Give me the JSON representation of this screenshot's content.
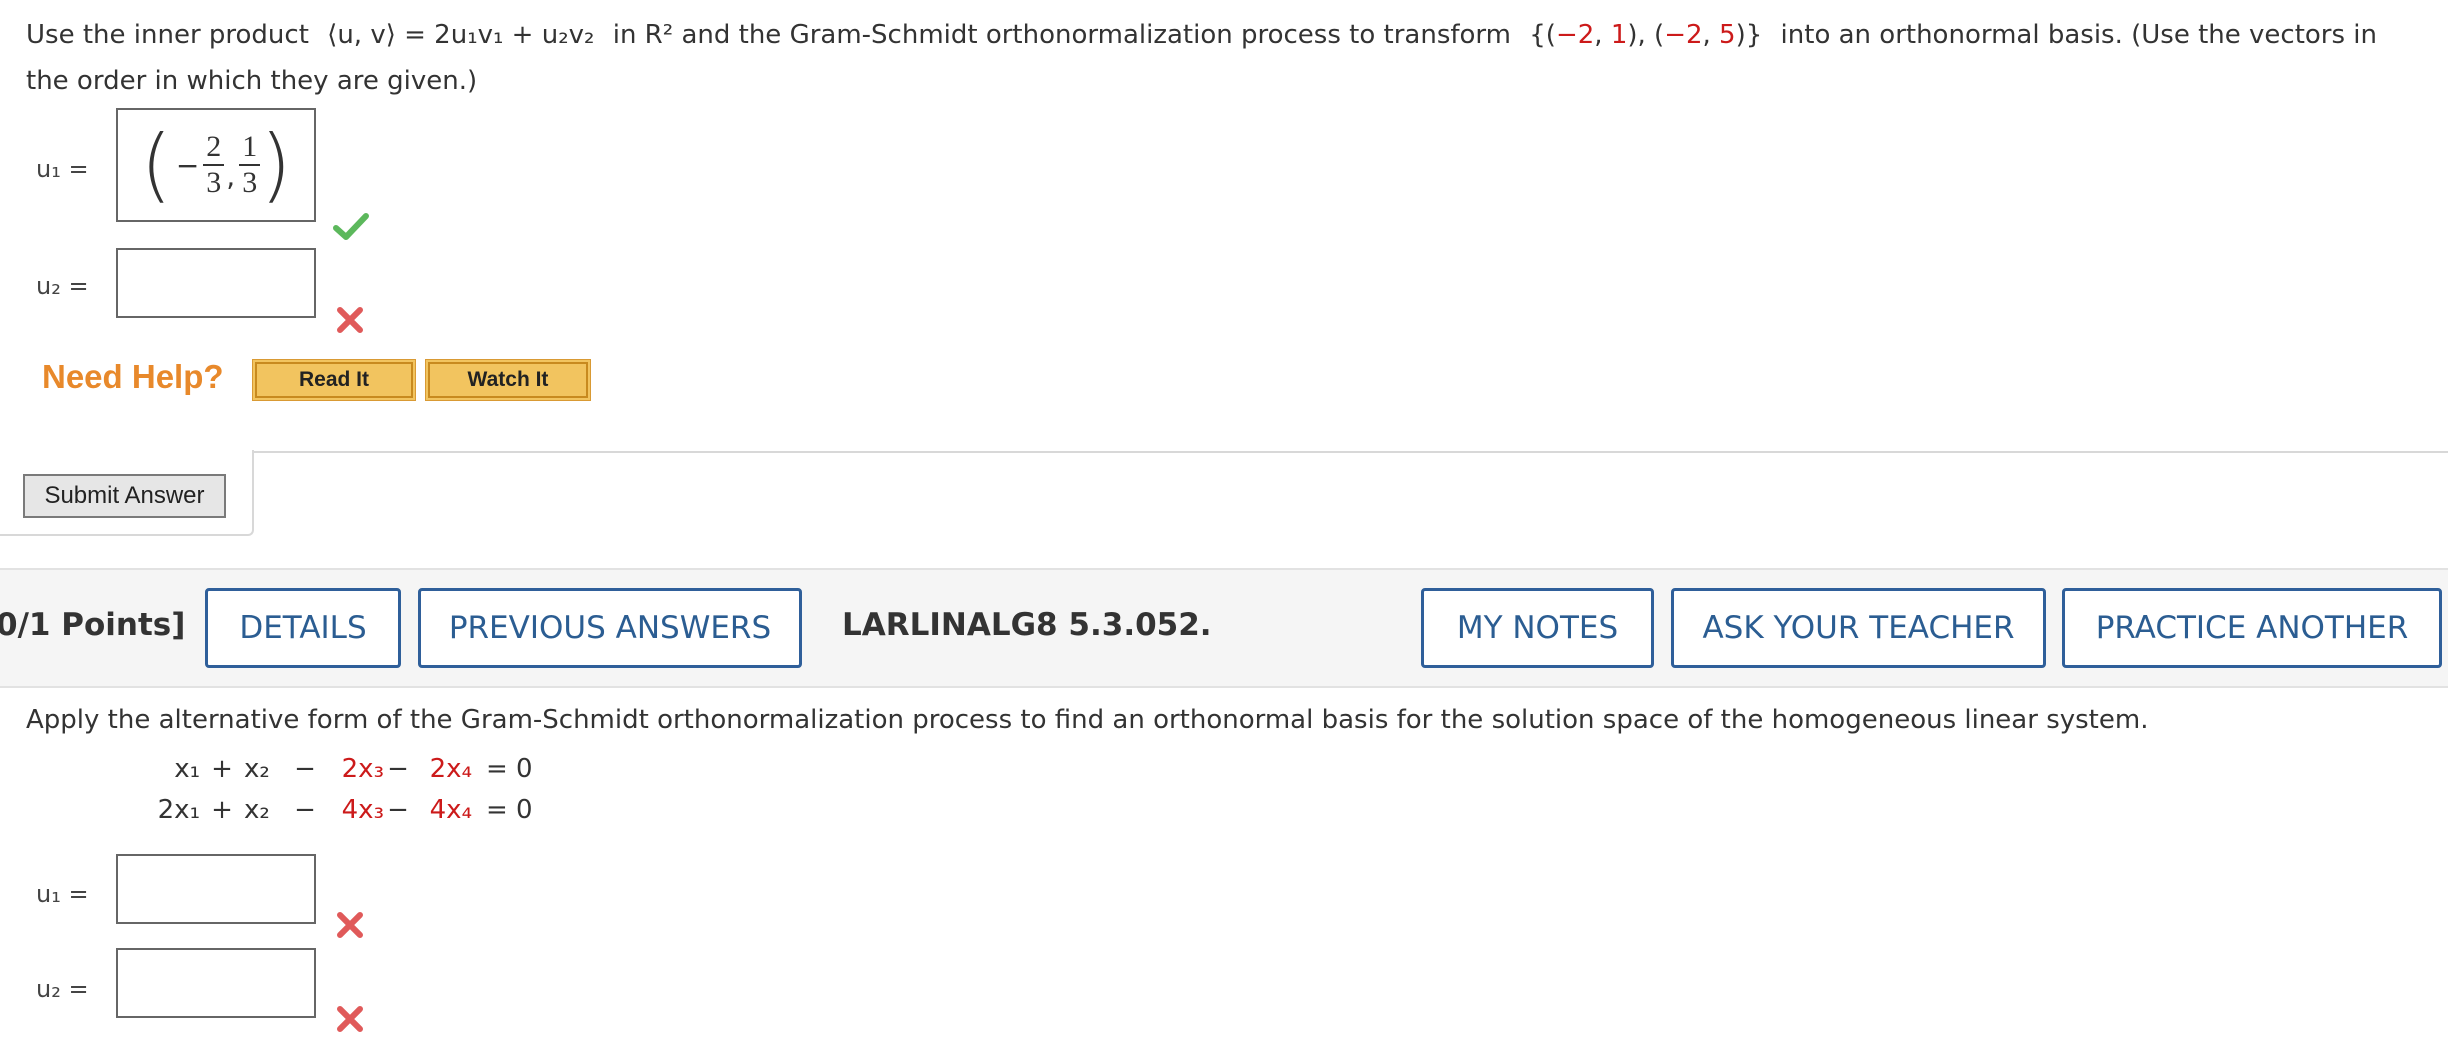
{
  "q1": {
    "prompt_pre": "Use the inner product",
    "inner_product": "⟨u, v⟩ = 2u₁v₁ + u₂v₂",
    "space": "in R²",
    "prompt_mid": "and the Gram-Schmidt orthonormalization process to transform",
    "set_open": "{(",
    "v1a": "−2",
    "comma1": ",",
    "v1b": "1",
    "set_sep": "), (",
    "v2a": "−2",
    "comma2": ",",
    "v2b": "5",
    "set_close": ")}",
    "prompt_post": "into an orthonormal basis. (Use the vectors in",
    "prompt_line2": "the order in which they are given.)",
    "u1_label": "u₁ =",
    "u1_answer": {
      "neg": "−",
      "n1": "2",
      "d1": "3",
      "sep": ",",
      "n2": "1",
      "d2": "3"
    },
    "u2_label": "u₂ =",
    "u2_value": "",
    "need_help": "Need Help?",
    "read_it": "Read It",
    "watch_it": "Watch It",
    "submit": "Submit Answer"
  },
  "q2": {
    "points": "0/1 Points]",
    "details": "DETAILS",
    "previous_answers": "PREVIOUS ANSWERS",
    "code": "LARLINALG8 5.3.052.",
    "my_notes": "MY NOTES",
    "ask_teacher": "ASK YOUR TEACHER",
    "practice_another": "PRACTICE ANOTHER",
    "prompt": "Apply the alternative form of the Gram-Schmidt orthonormalization process to find an orthonormal basis for the solution space of the homogeneous linear system.",
    "eq1": {
      "a": "x₁",
      "op1": "+",
      "b": "x₂",
      "op2": "−",
      "c": "2x₃",
      "op3": "−",
      "d": "2x₄",
      "rhs": "= 0"
    },
    "eq2": {
      "a": "2x₁",
      "op1": "+",
      "b": "x₂",
      "op2": "−",
      "c": "4x₃",
      "op3": "−",
      "d": "4x₄",
      "rhs": "= 0"
    },
    "u1_label": "u₁ =",
    "u2_label": "u₂ ="
  },
  "colors": {
    "red": "#cc1a1a",
    "link_blue": "#2b5d92",
    "help_orange": "#e8892b",
    "check_green": "#5cb85c",
    "x_red": "#e05a5a"
  }
}
